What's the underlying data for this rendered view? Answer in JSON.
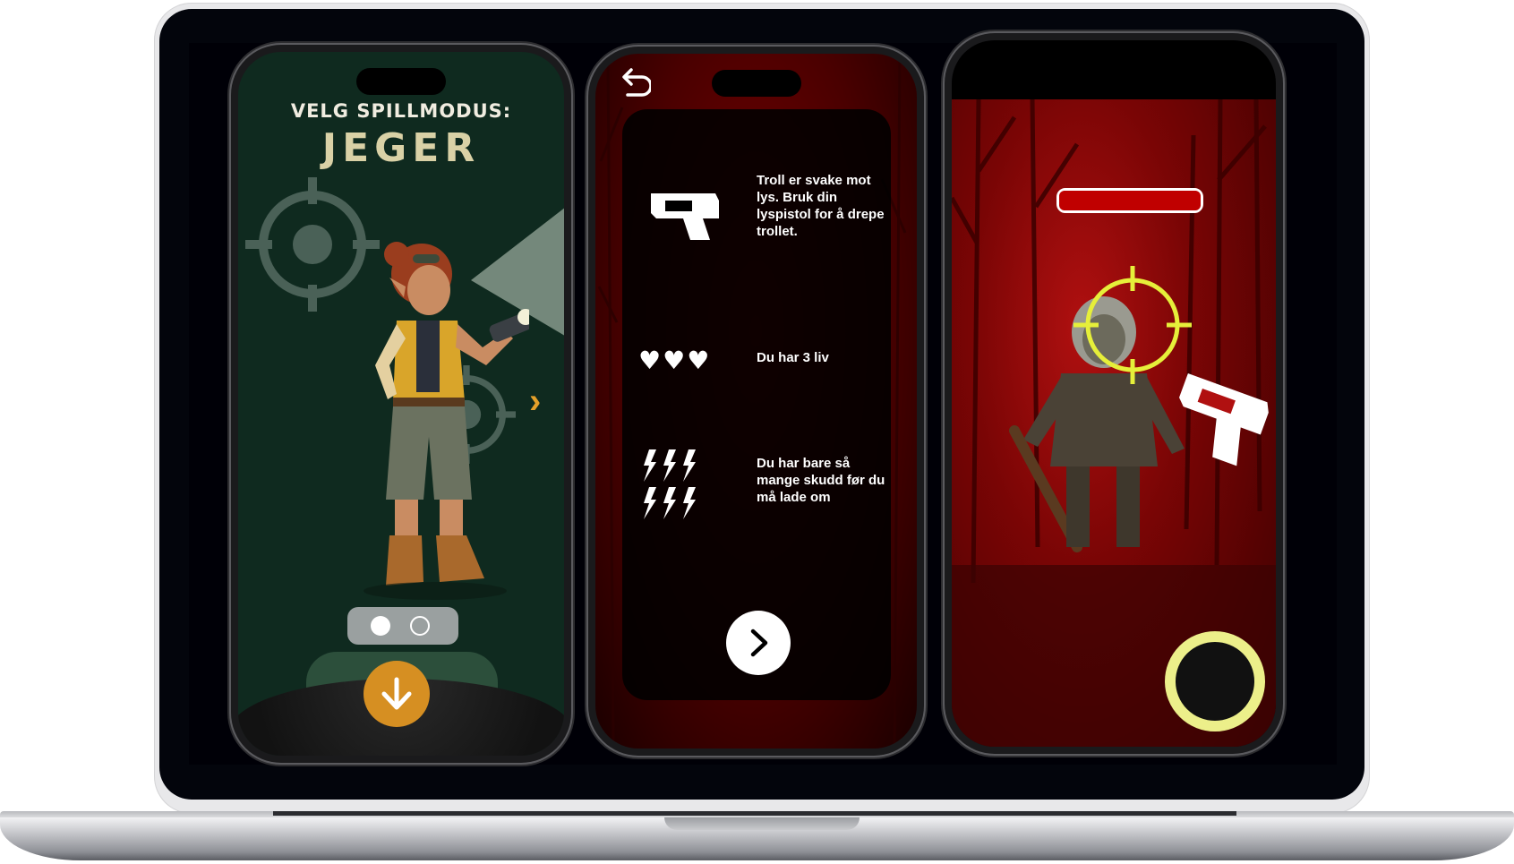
{
  "screen1": {
    "heading": "VELG SPILLMODUS:",
    "mode": "JEGER",
    "pager": {
      "count": 2,
      "active_index": 0
    }
  },
  "screen2": {
    "rules": [
      {
        "icon": "light-pistol-icon",
        "text": "Troll er svake mot lys. Bruk din lyspistol for å drepe trollet."
      },
      {
        "icon": "hearts-icon",
        "text": "Du har 3 liv"
      },
      {
        "icon": "lightning-bolts-icon",
        "text": "Du har bare så mange skudd før du må lade om"
      }
    ]
  },
  "screen3": {
    "health_fraction": 1.0
  },
  "colors": {
    "forest_green": "#0f2a1f",
    "title_cream": "#d9d1a6",
    "accent_orange": "#d68f22",
    "blood_red": "#b01010",
    "crosshair_yellow": "#e6ef3a"
  }
}
